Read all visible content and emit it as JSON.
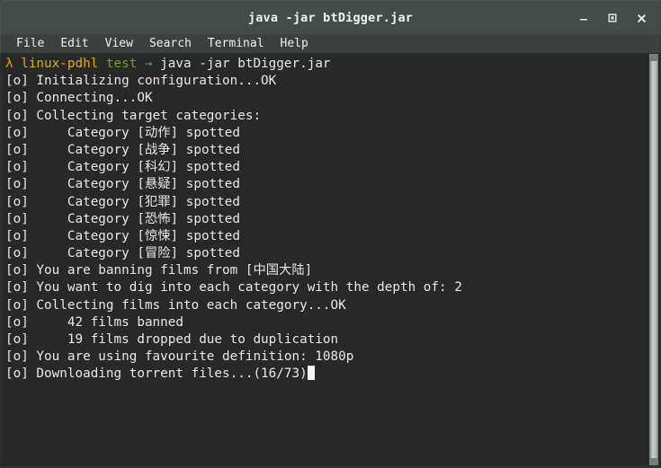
{
  "window": {
    "title": "java -jar btDigger.jar",
    "controls": [
      {
        "name": "minimize-button",
        "label": "–"
      },
      {
        "name": "maximize-button",
        "label": "□"
      },
      {
        "name": "close-button",
        "label": "×"
      }
    ]
  },
  "menubar": {
    "items": [
      {
        "label": "File"
      },
      {
        "label": "Edit"
      },
      {
        "label": "View"
      },
      {
        "label": "Search"
      },
      {
        "label": "Terminal"
      },
      {
        "label": "Help"
      }
    ]
  },
  "terminal": {
    "colors": {
      "background": "#282828",
      "foreground": "#e8e8e8",
      "titlebar": "#434c48",
      "menubar": "#3c403e",
      "prompt_lambda": "#d79921",
      "prompt_host": "#d6b016",
      "prompt_dir": "#66a818",
      "prompt_arrow": "#45a06a",
      "cursor": "#f4f4f4",
      "scrollbar_thumb": "#c9cfcb"
    },
    "prompt": {
      "lambda": "λ",
      "host": "linux-pdhl",
      "dir": "test",
      "arrow": "→",
      "command": "java -jar btDigger.jar"
    },
    "log_prefix": "[o]",
    "lines": [
      {
        "prefix": "[o]",
        "text": " Initializing configuration...OK"
      },
      {
        "prefix": "[o]",
        "text": " Connecting...OK"
      },
      {
        "prefix": "[o]",
        "text": " Collecting target categories:"
      },
      {
        "prefix": "[o]",
        "text": "     Category [动作] spotted"
      },
      {
        "prefix": "[o]",
        "text": "     Category [战争] spotted"
      },
      {
        "prefix": "[o]",
        "text": "     Category [科幻] spotted"
      },
      {
        "prefix": "[o]",
        "text": "     Category [悬疑] spotted"
      },
      {
        "prefix": "[o]",
        "text": "     Category [犯罪] spotted"
      },
      {
        "prefix": "[o]",
        "text": "     Category [恐怖] spotted"
      },
      {
        "prefix": "[o]",
        "text": "     Category [惊悚] spotted"
      },
      {
        "prefix": "[o]",
        "text": "     Category [冒险] spotted"
      },
      {
        "prefix": "[o]",
        "text": " You are banning films from [中国大陆]"
      },
      {
        "prefix": "[o]",
        "text": " You want to dig into each category with the depth of: 2"
      },
      {
        "prefix": "[o]",
        "text": " Collecting films into each category...OK"
      },
      {
        "prefix": "[o]",
        "text": "     42 films banned"
      },
      {
        "prefix": "[o]",
        "text": "     19 films dropped due to duplication"
      },
      {
        "prefix": "[o]",
        "text": " You are using favourite definition: 1080p"
      },
      {
        "prefix": "[o]",
        "text": " Downloading torrent files...(16/73)",
        "cursor": true
      }
    ],
    "categories": [
      "动作",
      "战争",
      "科幻",
      "悬疑",
      "犯罪",
      "恐怖",
      "惊悚",
      "冒险"
    ],
    "stats": {
      "banned_region": "中国大陆",
      "depth": "2",
      "films_banned": "42",
      "films_dropped": "19",
      "definition": "1080p",
      "download_progress": "(16/73)",
      "downloaded": "16",
      "total": "73"
    }
  }
}
